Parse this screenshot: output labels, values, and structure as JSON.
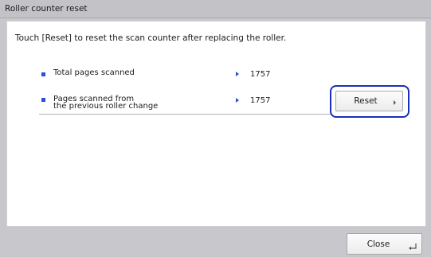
{
  "window": {
    "title": "Roller counter reset"
  },
  "instruction": "Touch [Reset] to reset the scan counter after replacing the roller.",
  "counters": [
    {
      "label_line1": "Total pages scanned",
      "label_line2": "",
      "value": "1757"
    },
    {
      "label_line1": "Pages scanned from",
      "label_line2": "the previous roller change",
      "value": "1757"
    }
  ],
  "reset_button": {
    "label": "Reset"
  },
  "close_button": {
    "label": "Close"
  },
  "colors": {
    "accent": "#2a4fd8",
    "focus_outline": "#1a2fb8",
    "frame": "#c8c8cc",
    "panel": "#ffffff"
  },
  "icons": {
    "bullet": "square-bullet-icon",
    "value_arrow": "right-triangle-icon",
    "reset_chevron": "chevron-right-icon",
    "close_enter": "enter-return-icon"
  }
}
